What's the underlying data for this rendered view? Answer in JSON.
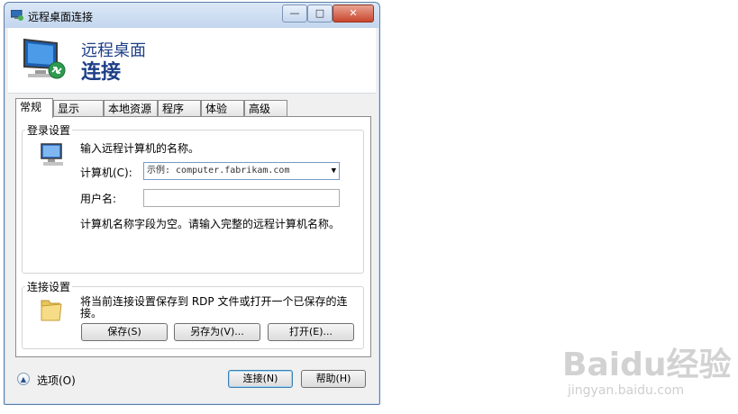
{
  "window": {
    "title": "远程桌面连接",
    "controls": {
      "minimize": "—",
      "maximize": "□",
      "close": "✕"
    }
  },
  "banner": {
    "line1": "远程桌面",
    "line2": "连接"
  },
  "tabs": [
    {
      "label": "常规",
      "active": true
    },
    {
      "label": "显示"
    },
    {
      "label": "本地资源"
    },
    {
      "label": "程序"
    },
    {
      "label": "体验"
    },
    {
      "label": "高级"
    }
  ],
  "login": {
    "group_label": "登录设置",
    "prompt": "输入远程计算机的名称。",
    "computer_label": "计算机(C):",
    "computer_placeholder": "示例: computer.fabrikam.com",
    "user_label": "用户名:",
    "user_value": "",
    "empty_notice": "计算机名称字段为空。请输入完整的远程计算机名称。"
  },
  "connection": {
    "group_label": "连接设置",
    "description_line1": "将当前连接设置保存到 RDP 文件或打开一个已保存的连",
    "description_line2": "接。",
    "save_button": "保存(S)",
    "save_as_button": "另存为(V)...",
    "open_button": "打开(E)..."
  },
  "footer": {
    "options_label": "选项(O)",
    "connect_button": "连接(N)",
    "help_button": "帮助(H)"
  },
  "watermark": {
    "logo": "Baidu经验",
    "url": "jingyan.baidu.com"
  },
  "colors": {
    "title_blue": "#1e3f87",
    "close_red": "#c9462c",
    "frame": "#5d7fa8"
  },
  "icons": [
    "rdp-app-icon",
    "monitor-icon",
    "computer-icon",
    "folder-icon",
    "chevron-up-icon",
    "dropdown-arrow-icon"
  ]
}
